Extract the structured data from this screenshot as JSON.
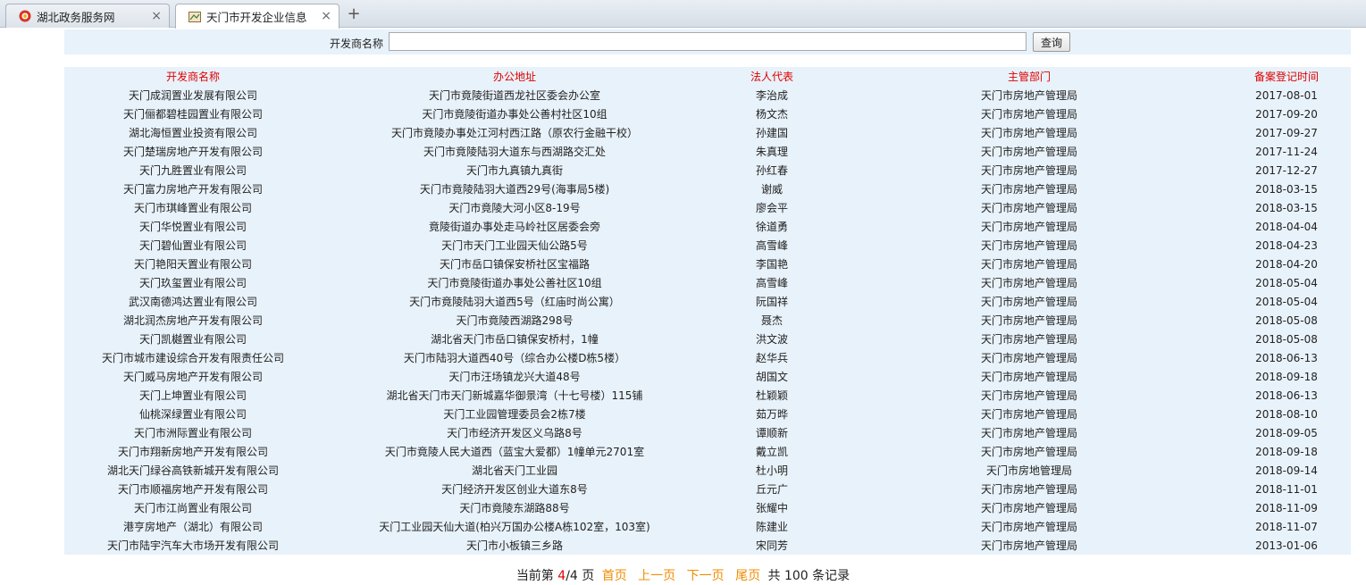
{
  "tabs": [
    {
      "label": "湖北政务服务网"
    },
    {
      "label": "天门市开发企业信息"
    }
  ],
  "new_tab_label": "+",
  "close_glyph": "×",
  "search": {
    "label": "开发商名称",
    "value": "",
    "button_label": "查询"
  },
  "table": {
    "headers": [
      "开发商名称",
      "办公地址",
      "法人代表",
      "主管部门",
      "备案登记时间"
    ],
    "rows": [
      [
        "天门成润置业发展有限公司",
        "天门市竟陵街道西龙社区委会办公室",
        "李治成",
        "天门市房地产管理局",
        "2017-08-01"
      ],
      [
        "天门俪都碧桂园置业有限公司",
        "天门市竟陵街道办事处公善村社区10组",
        "杨文杰",
        "天门市房地产管理局",
        "2017-09-20"
      ],
      [
        "湖北海恒置业投资有限公司",
        "天门市竟陵办事处江河村西江路（原农行金融干校）",
        "孙建国",
        "天门市房地产管理局",
        "2017-09-27"
      ],
      [
        "天门楚瑞房地产开发有限公司",
        "天门市竟陵陆羽大道东与西湖路交汇处",
        "朱真理",
        "天门市房地产管理局",
        "2017-11-24"
      ],
      [
        "天门九胜置业有限公司",
        "天门市九真镇九真街",
        "孙红春",
        "天门市房地产管理局",
        "2017-12-27"
      ],
      [
        "天门富力房地产开发有限公司",
        "天门市竟陵陆羽大道西29号(海事局5楼)",
        "谢威",
        "天门市房地产管理局",
        "2018-03-15"
      ],
      [
        "天门市琪峰置业有限公司",
        "天门市竟陵大河小区8-19号",
        "廖会平",
        "天门市房地产管理局",
        "2018-03-15"
      ],
      [
        "天门华悦置业有限公司",
        "竟陵街道办事处走马岭社区居委会旁",
        "徐道勇",
        "天门市房地产管理局",
        "2018-04-04"
      ],
      [
        "天门碧仙置业有限公司",
        "天门市天门工业园天仙公路5号",
        "高雪峰",
        "天门市房地产管理局",
        "2018-04-23"
      ],
      [
        "天门艳阳天置业有限公司",
        "天门市岳口镇保安桥社区宝福路",
        "李国艳",
        "天门市房地产管理局",
        "2018-04-20"
      ],
      [
        "天门玖玺置业有限公司",
        "天门市竟陵街道办事处公善社区10组",
        "高雪峰",
        "天门市房地产管理局",
        "2018-05-04"
      ],
      [
        "武汉南德鸿达置业有限公司",
        "天门市竟陵陆羽大道西5号（红庙时尚公寓）",
        "阮国祥",
        "天门市房地产管理局",
        "2018-05-04"
      ],
      [
        "湖北润杰房地产开发有限公司",
        "天门市竟陵西湖路298号",
        "聂杰",
        "天门市房地产管理局",
        "2018-05-08"
      ],
      [
        "天门凯樾置业有限公司",
        "湖北省天门市岳口镇保安桥村，1幢",
        "洪文波",
        "天门市房地产管理局",
        "2018-05-08"
      ],
      [
        "天门市城市建设综合开发有限责任公司",
        "天门市陆羽大道西40号（综合办公楼D栋5楼）",
        "赵华兵",
        "天门市房地产管理局",
        "2018-06-13"
      ],
      [
        "天门威马房地产开发有限公司",
        "天门市汪场镇龙兴大道48号",
        "胡国文",
        "天门市房地产管理局",
        "2018-09-18"
      ],
      [
        "天门上坤置业有限公司",
        "湖北省天门市天门新城嘉华御景湾（十七号楼）115铺",
        "杜颖颖",
        "天门市房地产管理局",
        "2018-06-13"
      ],
      [
        "仙桃深绿置业有限公司",
        "天门工业园管理委员会2栋7楼",
        "茹万晔",
        "天门市房地产管理局",
        "2018-08-10"
      ],
      [
        "天门市洲际置业有限公司",
        "天门市经济开发区义乌路8号",
        "谭顺新",
        "天门市房地产管理局",
        "2018-09-05"
      ],
      [
        "天门市翔新房地产开发有限公司",
        "天门市竟陵人民大道西（蓝宝大爱都）1幢单元2701室",
        "戴立凯",
        "天门市房地产管理局",
        "2018-09-18"
      ],
      [
        "湖北天门绿谷高铁新城开发有限公司",
        "湖北省天门工业园",
        "杜小明",
        "天门市房地管理局",
        "2018-09-14"
      ],
      [
        "天门市顺福房地产开发有限公司",
        "天门经济开发区创业大道东8号",
        "丘元广",
        "天门市房地产管理局",
        "2018-11-01"
      ],
      [
        "天门市江尚置业有限公司",
        "天门市竟陵东湖路88号",
        "张耀中",
        "天门市房地产管理局",
        "2018-11-09"
      ],
      [
        "港亨房地产（湖北）有限公司",
        "天门工业园天仙大道(柏兴万国办公楼A栋102室，103室)",
        "陈建业",
        "天门市房地产管理局",
        "2018-11-07"
      ],
      [
        "天门市陆宇汽车大市场开发有限公司",
        "天门市小板镇三乡路",
        "宋同芳",
        "天门市房地产管理局",
        "2013-01-06"
      ]
    ]
  },
  "pager": {
    "prefix": "当前第",
    "current": "4",
    "total_pages": "/4",
    "page_word": "页",
    "first": "首页",
    "prev": "上一页",
    "next": "下一页",
    "last": "尾页",
    "total_prefix": "共",
    "total_records": "100",
    "total_suffix": "条记录"
  }
}
